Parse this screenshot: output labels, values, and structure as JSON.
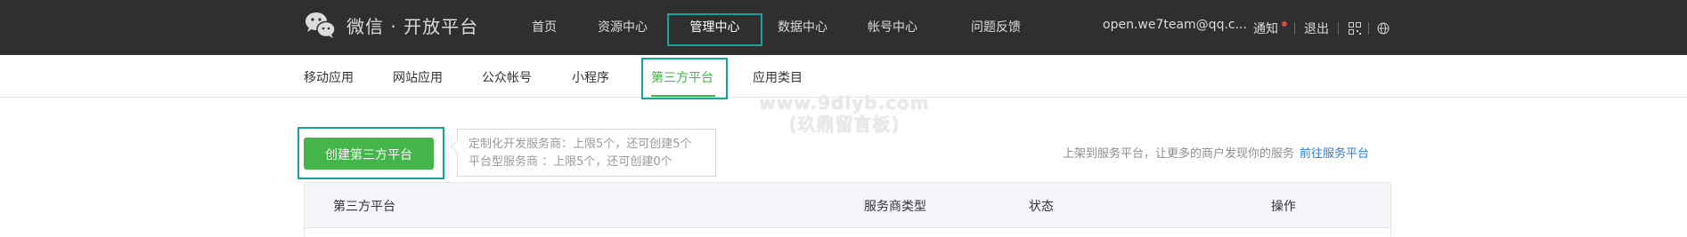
{
  "header": {
    "logo_text": "微信 · 开放平台",
    "nav": [
      {
        "label": "首页"
      },
      {
        "label": "资源中心"
      },
      {
        "label": "管理中心"
      },
      {
        "label": "数据中心"
      },
      {
        "label": "帐号中心"
      },
      {
        "label": "问题反馈"
      }
    ],
    "email": "open.we7team@qq.c...",
    "notify_label": "通知",
    "logout_label": "退出"
  },
  "subnav": {
    "items": [
      {
        "label": "移动应用"
      },
      {
        "label": "网站应用"
      },
      {
        "label": "公众帐号"
      },
      {
        "label": "小程序"
      },
      {
        "label": "第三方平台"
      },
      {
        "label": "应用类目"
      }
    ]
  },
  "watermark": {
    "line1": "www.9dlyb.com",
    "line2": "(玖鼎留言板)"
  },
  "main": {
    "create_button": "创建第三方平台",
    "tip_line1": "定制化开发服务商：上限5个，还可创建5个",
    "tip_line2": "平台型服务商 ：上限5个，还可创建0个",
    "promo_text": "上架到服务平台，让更多的商户发现你的服务",
    "promo_link": "前往服务平台"
  },
  "table": {
    "columns": [
      "第三方平台",
      "服务商类型",
      "状态",
      "操作"
    ]
  },
  "colors": {
    "topbar": "#2f2f2f",
    "accent_green": "#44b549",
    "highlight_teal": "#18a39a",
    "link_blue": "#2a7de1"
  }
}
